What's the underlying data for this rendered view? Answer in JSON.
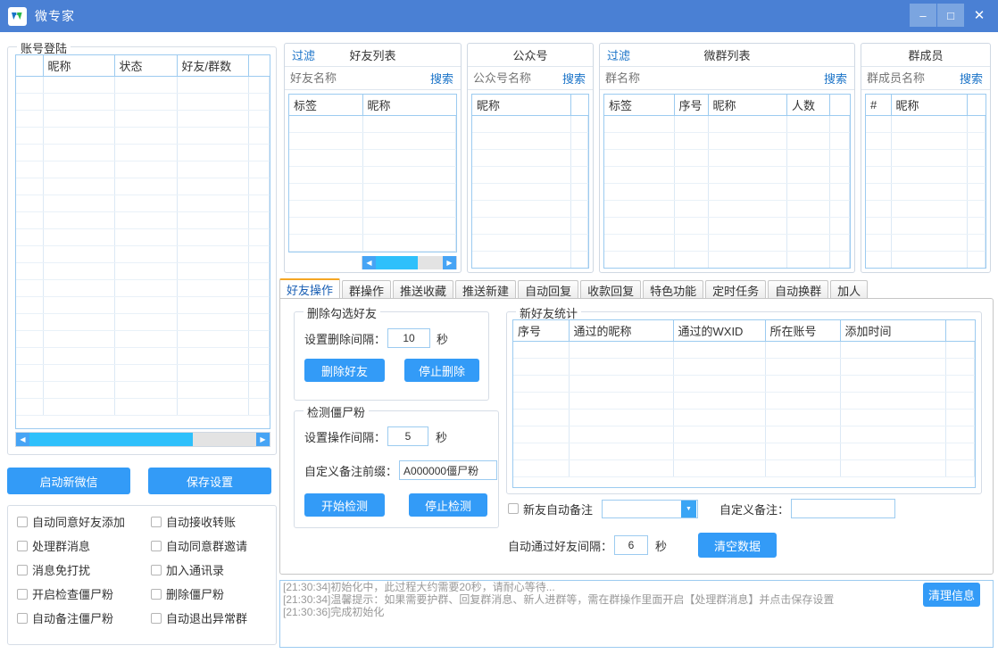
{
  "window": {
    "title": "微专家",
    "logo_icon": "w-logo-icon",
    "minimize_icon": "–",
    "maximize_icon": "□",
    "close_icon": "✕",
    "titlebar_color": "#4a80d4"
  },
  "account_group": {
    "legend": "账号登陆",
    "columns": [
      "",
      "昵称",
      "状态",
      "好友/群数",
      ""
    ],
    "rows": [],
    "scroll": {
      "left_arrow": "◀",
      "right_arrow": "▶",
      "thumb_percent": 72
    }
  },
  "left_buttons": {
    "new_wechat": "启动新微信",
    "save_settings": "保存设置"
  },
  "checkboxes": [
    {
      "label": "自动同意好友添加",
      "checked": false
    },
    {
      "label": "自动接收转账",
      "checked": false
    },
    {
      "label": "处理群消息",
      "checked": false
    },
    {
      "label": "自动同意群邀请",
      "checked": false
    },
    {
      "label": "消息免打扰",
      "checked": false
    },
    {
      "label": "加入通讯录",
      "checked": false
    },
    {
      "label": "开启检查僵尸粉",
      "checked": false
    },
    {
      "label": "删除僵尸粉",
      "checked": false
    },
    {
      "label": "自动备注僵尸粉",
      "checked": false
    },
    {
      "label": "自动退出异常群",
      "checked": false
    }
  ],
  "friend_panel": {
    "filter": "过滤",
    "title": "好友列表",
    "search_placeholder": "好友名称",
    "search_label": "搜索",
    "columns": [
      "标签",
      "昵称"
    ],
    "scroll": {
      "left_arrow": "◀",
      "right_arrow": "▶",
      "thumb_percent": 62
    }
  },
  "public_panel": {
    "filter": "",
    "title": "公众号",
    "search_placeholder": "公众号名称",
    "search_label": "搜索",
    "columns": [
      "昵称",
      ""
    ]
  },
  "group_panel": {
    "filter": "过滤",
    "title": "微群列表",
    "search_placeholder": "群名称",
    "search_label": "搜索",
    "columns": [
      "标签",
      "序号",
      "昵称",
      "人数",
      ""
    ]
  },
  "member_panel": {
    "filter": "",
    "title": "群成员",
    "search_placeholder": "群成员名称",
    "search_label": "搜索",
    "columns": [
      "#",
      "昵称",
      ""
    ]
  },
  "tabs": [
    {
      "label": "好友操作",
      "active": true
    },
    {
      "label": "群操作",
      "active": false
    },
    {
      "label": "推送收藏",
      "active": false
    },
    {
      "label": "推送新建",
      "active": false
    },
    {
      "label": "自动回复",
      "active": false
    },
    {
      "label": "收款回复",
      "active": false
    },
    {
      "label": "特色功能",
      "active": false
    },
    {
      "label": "定时任务",
      "active": false
    },
    {
      "label": "自动换群",
      "active": false
    },
    {
      "label": "加人",
      "active": false
    }
  ],
  "delete_group": {
    "legend": "删除勾选好友",
    "interval_label": "设置删除间隔：",
    "interval_value": "10",
    "unit": "秒",
    "delete_button": "删除好友",
    "stop_button": "停止删除"
  },
  "zombie_group": {
    "legend": "检测僵尸粉",
    "interval_label": "设置操作间隔：",
    "interval_value": "5",
    "unit": "秒",
    "prefix_label": "自定义备注前缀：",
    "prefix_value": "A000000僵尸粉",
    "start_button": "开始检测",
    "stop_button": "停止检测"
  },
  "stats_group": {
    "legend": "新好友统计",
    "columns": [
      "序号",
      "通过的昵称",
      "通过的WXID",
      "所在账号",
      "添加时间",
      ""
    ],
    "rows": []
  },
  "bottom_controls": {
    "auto_remark_checkbox": "新友自动备注",
    "auto_remark_checked": false,
    "auto_remark_select_value": "",
    "select_arrow": "▼",
    "custom_remark_label": "自定义备注：",
    "custom_remark_value": "",
    "pass_interval_label": "自动通过好友间隔：",
    "pass_interval_value": "6",
    "pass_interval_unit": "秒",
    "clear_data_button": "清空数据"
  },
  "log": {
    "lines": [
      "[21:30:34]初始化中，此过程大约需要20秒，请耐心等待...",
      "[21:30:34]温馨提示：如果需要护群、回复群消息、新人进群等，需在群操作里面开启【处理群消息】并点击保存设置",
      "[21:30:36]完成初始化"
    ],
    "clear_button": "清理信息"
  },
  "colors": {
    "accent_blue": "#339bf7",
    "title_blue": "#4a80d4",
    "grid_border": "#9ccbf0",
    "tab_active": "#f5a623"
  }
}
